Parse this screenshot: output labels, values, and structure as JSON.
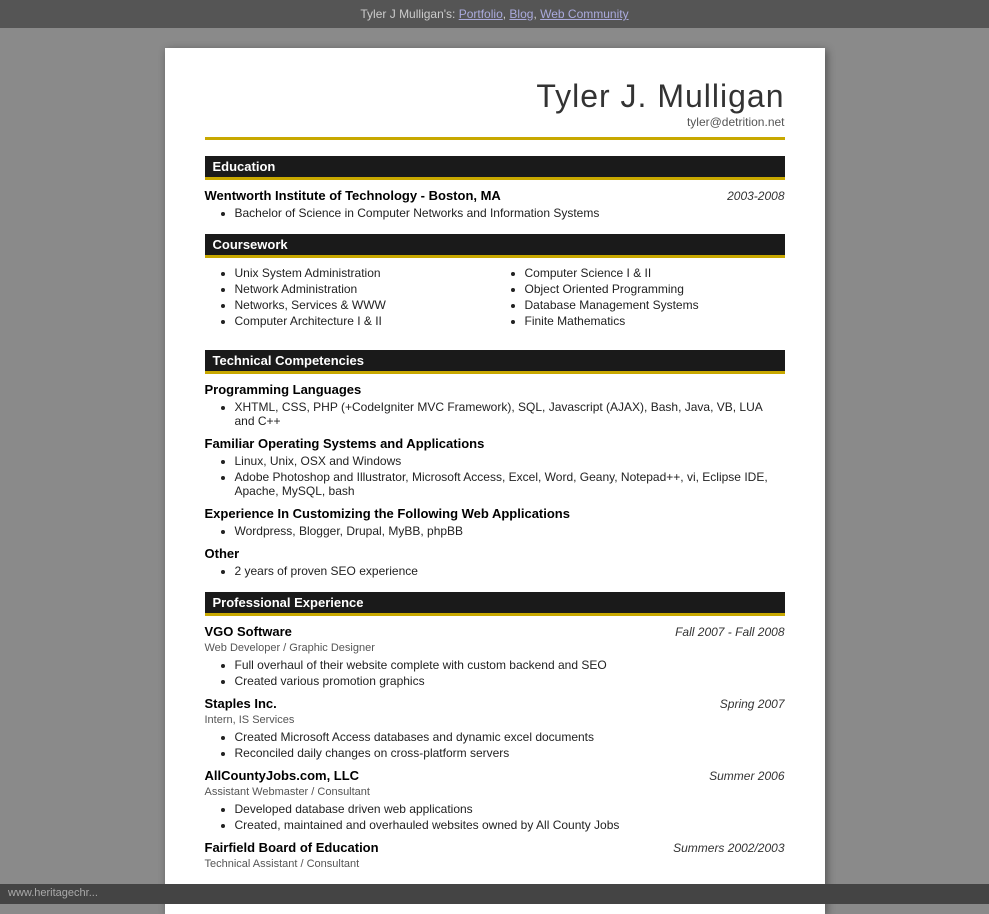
{
  "topbar": {
    "text": "Tyler J Mulligan's: ",
    "links": [
      {
        "label": "Portfolio",
        "href": "#"
      },
      {
        "label": "Blog",
        "href": "#"
      },
      {
        "label": "Web Community",
        "href": "#"
      }
    ]
  },
  "resume": {
    "name": "Tyler J. Mulligan",
    "email": "tyler@detrition.net",
    "sections": {
      "education": {
        "header": "Education",
        "school": "Wentworth Institute of Technology - Boston, MA",
        "dates": "2003-2008",
        "items": [
          "Bachelor of Science in Computer Networks and Information Systems"
        ]
      },
      "coursework": {
        "header": "Coursework",
        "col1": [
          "Unix System Administration",
          "Network Administration",
          "Networks, Services & WWW",
          "Computer Architecture I & II"
        ],
        "col2": [
          "Computer Science I & II",
          "Object Oriented Programming",
          "Database Management Systems",
          "Finite Mathematics"
        ]
      },
      "technical": {
        "header": "Technical Competencies",
        "groups": [
          {
            "title": "Programming Languages",
            "items": [
              "XHTML, CSS, PHP (+CodeIgniter MVC Framework), SQL, Javascript (AJAX), Bash, Java, VB, LUA and C++"
            ]
          },
          {
            "title": "Familiar Operating Systems and Applications",
            "items": [
              "Linux, Unix, OSX and Windows",
              "Adobe Photoshop and Illustrator, Microsoft Access, Excel, Word, Geany, Notepad++, vi, Eclipse IDE, Apache, MySQL, bash"
            ]
          },
          {
            "title": "Experience In Customizing the Following Web Applications",
            "items": [
              "Wordpress, Blogger, Drupal, MyBB, phpBB"
            ]
          },
          {
            "title": "Other",
            "items": [
              "2 years of proven SEO experience"
            ]
          }
        ]
      },
      "experience": {
        "header": "Professional Experience",
        "jobs": [
          {
            "company": "VGO Software",
            "dates": "Fall 2007 - Fall 2008",
            "subtitle": "Web Developer / Graphic Designer",
            "items": [
              "Full overhaul of their website complete with custom backend and SEO",
              "Created various promotion graphics"
            ]
          },
          {
            "company": "Staples Inc.",
            "dates": "Spring 2007",
            "subtitle": "Intern, IS Services",
            "items": [
              "Created Microsoft Access databases and dynamic excel documents",
              "Reconciled daily changes on cross-platform servers"
            ]
          },
          {
            "company": "AllCountyJobs.com, LLC",
            "dates": "Summer 2006",
            "subtitle": "Assistant Webmaster / Consultant",
            "items": [
              "Developed database driven web applications",
              "Created, maintained and overhauled websites owned by All County Jobs"
            ]
          },
          {
            "company": "Fairfield Board of Education",
            "dates": "Summers 2002/2003",
            "subtitle": "Technical Assistant / Consultant",
            "items": []
          }
        ]
      }
    }
  },
  "bottombar": {
    "text": "www.heritagechr..."
  }
}
